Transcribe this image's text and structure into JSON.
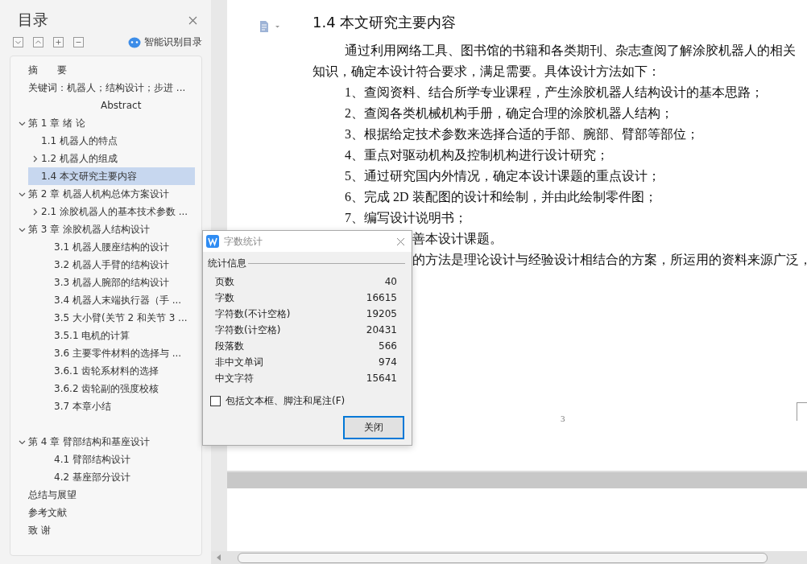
{
  "sidebar": {
    "title": "目录",
    "smart_button": "智能识别目录",
    "items": [
      {
        "label": "摘　　要",
        "selected": false
      },
      {
        "label": "关键词：机器人；结构设计；步进 ...",
        "selected": false
      },
      {
        "label": "Abstract",
        "kind": "centered",
        "selected": false
      },
      {
        "label": "第 1 章  绪  论",
        "expanded": true,
        "selected": false,
        "children": [
          {
            "label": "1.1 机器人的特点",
            "selected": false
          },
          {
            "label": "1.2 机器人的组成",
            "expanded": false,
            "selected": false
          },
          {
            "label": "1.4  本文研究主要内容",
            "selected": true
          }
        ]
      },
      {
        "label": "第 2 章  机器人机构总体方案设计",
        "expanded": true,
        "selected": false,
        "children": [
          {
            "label": "2.1 涂胶机器人的基本技术参数 ...",
            "expanded": false,
            "selected": false
          }
        ]
      },
      {
        "label": "第 3 章  涂胶机器人结构设计",
        "expanded": true,
        "selected": false,
        "children": [
          {
            "label": "3.1  机器人腰座结构的设计",
            "kind": "deep",
            "selected": false
          },
          {
            "label": "3.2  机器人手臂的结构设计",
            "kind": "deep",
            "selected": false
          },
          {
            "label": "3.3    机器人腕部的结构设计",
            "kind": "deep",
            "selected": false
          },
          {
            "label": "3.4    机器人末端执行器（手 ...",
            "kind": "deep",
            "selected": false
          },
          {
            "label": "3.5    大小臂(关节 2 和关节 3 ...",
            "kind": "deep",
            "selected": false
          },
          {
            "label": "3.5.1  电机的计算",
            "kind": "deep",
            "selected": false
          },
          {
            "label": "3.6  主要零件材料的选择与 ...",
            "kind": "deep",
            "selected": false
          },
          {
            "label": "3.6.1  齿轮系材料的选择",
            "kind": "deep",
            "selected": false
          },
          {
            "label": "3.6.2    齿轮副的强度校核",
            "kind": "deep",
            "selected": false
          },
          {
            "label": "3.7 本章小结",
            "kind": "deep",
            "selected": false
          }
        ]
      },
      {
        "label": "第 4 章    臂部结构和基座设计",
        "expanded": true,
        "kind": "spaced",
        "selected": false,
        "children": [
          {
            "label": "4.1  臂部结构设计",
            "kind": "deep",
            "selected": false
          },
          {
            "label": "4.2 基座部分设计",
            "kind": "deep",
            "selected": false
          }
        ]
      },
      {
        "label": "总结与展望",
        "selected": false
      },
      {
        "label": "参考文献",
        "selected": false
      },
      {
        "label": "致  谢",
        "selected": false
      }
    ]
  },
  "document": {
    "heading": "1.4  本文研究主要内容",
    "lines": [
      {
        "kind": "para",
        "text": "通过利用网络工具、图书馆的书籍和各类期刊、杂志查阅了解涂胶机器人的相关知识，确定本设计符合要求，满足需要。具体设计方法如下："
      },
      {
        "kind": "item",
        "text": "1、查阅资料、结合所学专业课程，产生涂胶机器人结构设计的基本思路；"
      },
      {
        "kind": "item",
        "text": "2、查阅各类机械机构手册，确定合理的涂胶机器人结构；"
      },
      {
        "kind": "item",
        "text": "3、根据给定技术参数来选择合适的手部、腕部、臂部等部位；"
      },
      {
        "kind": "item",
        "text": "4、重点对驱动机构及控制机构进行设计研究；"
      },
      {
        "kind": "item",
        "text": "5、通过研究国内外情况，确定本设计课题的重点设计；"
      },
      {
        "kind": "item",
        "text": "6、完成 2D 装配图的设计和绘制，并由此绘制零件图；"
      },
      {
        "kind": "item",
        "text": "7、编写设计说明书；"
      },
      {
        "kind": "cut",
        "text": "善本设计课题。"
      },
      {
        "kind": "cut",
        "text": "的方法是理论设计与经验设计相结合的方案，所运用的资料来源广泛，"
      }
    ],
    "page_number": "3"
  },
  "dialog": {
    "title": "字数统计",
    "section": "统计信息",
    "stats": [
      {
        "label": "页数",
        "value": "40"
      },
      {
        "label": "字数",
        "value": "16615"
      },
      {
        "label": "字符数(不计空格)",
        "value": "19205"
      },
      {
        "label": "字符数(计空格)",
        "value": "20431"
      },
      {
        "label": "段落数",
        "value": "566"
      },
      {
        "label": "非中文单词",
        "value": "974"
      },
      {
        "label": "中文字符",
        "value": "15641"
      }
    ],
    "checkbox": {
      "label": "包括文本框、脚注和尾注(F)",
      "checked": false
    },
    "close_button": "关闭"
  }
}
